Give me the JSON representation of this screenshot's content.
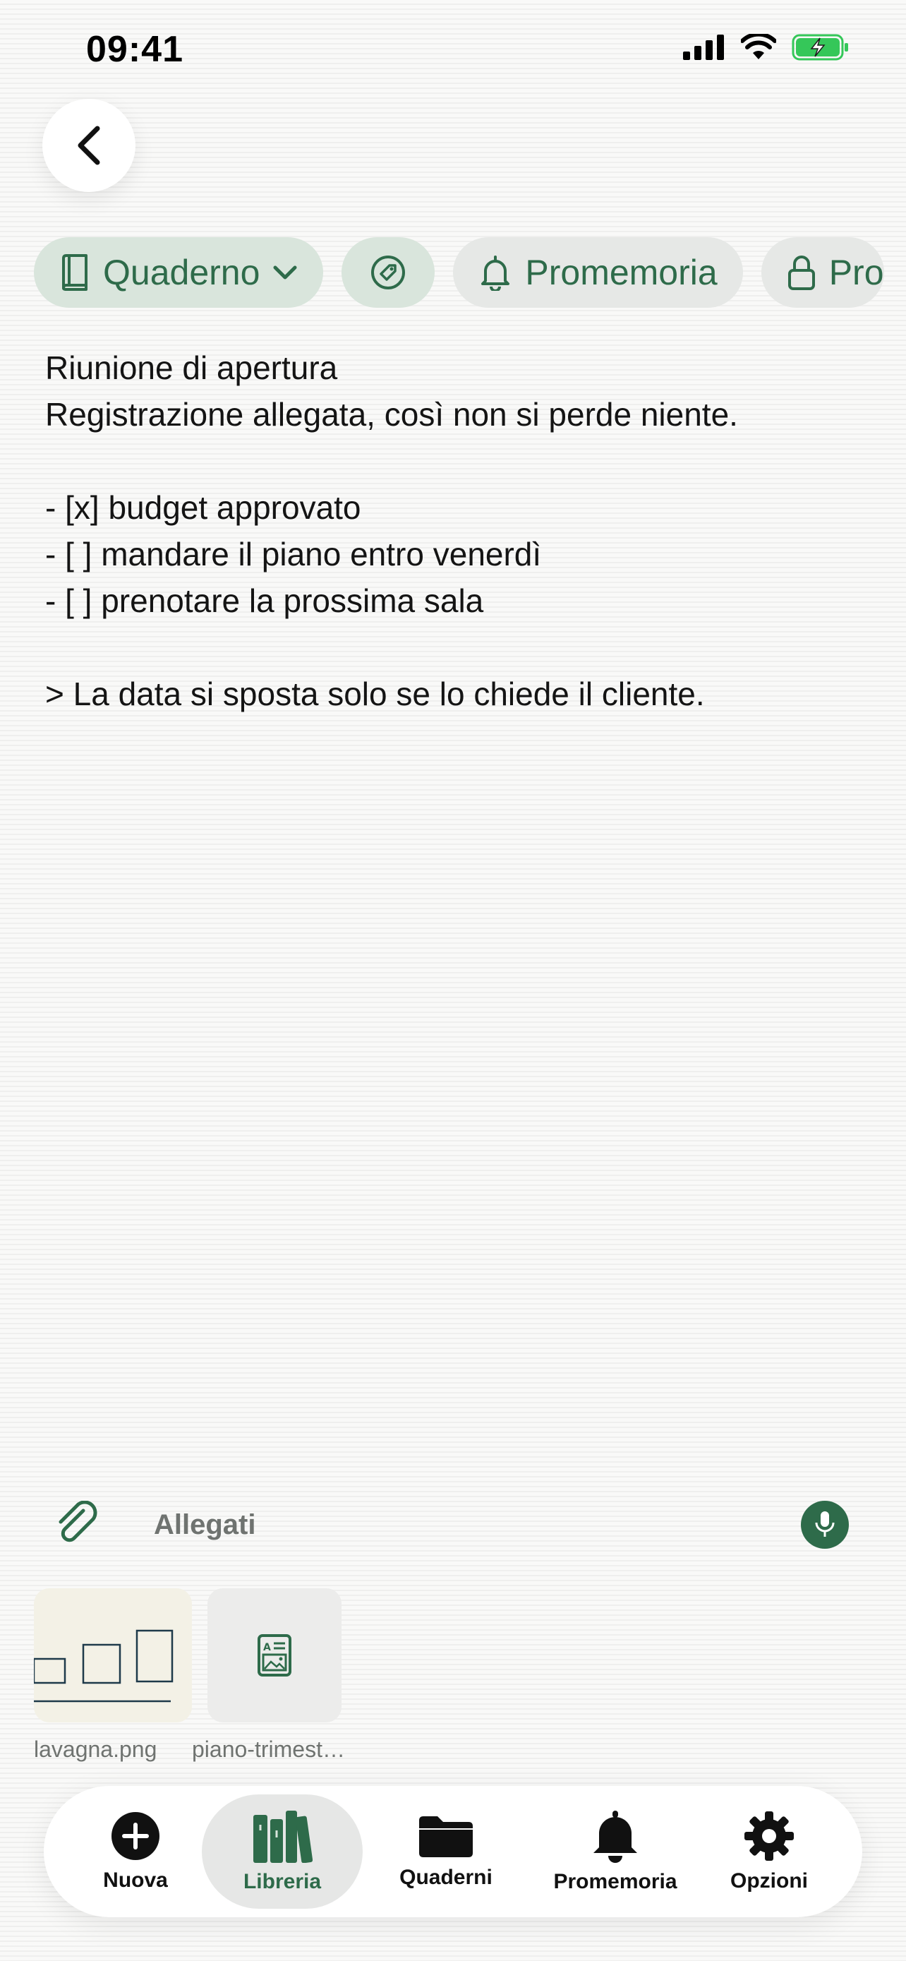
{
  "status_bar": {
    "time": "09:41",
    "icons": [
      "signal-icon",
      "wifi-icon",
      "battery-charging-icon"
    ]
  },
  "toolbar": {
    "back_icon": "chevron-left-icon"
  },
  "chips": [
    {
      "label": "Quaderno",
      "icon": "notebook-icon",
      "has_dropdown": true
    },
    {
      "label": "",
      "icon": "tag-icon"
    },
    {
      "label": "Promemoria",
      "icon": "bell-icon"
    },
    {
      "label": "Pro",
      "icon": "lock-icon"
    }
  ],
  "note": {
    "lines": [
      "Riunione di apertura",
      "Registrazione allegata, così non si perde niente.",
      "",
      "- [x] budget approvato",
      "- [ ] mandare il piano entro venerdì",
      "- [ ] prenotare la prossima sala",
      "",
      "> La data si sposta solo se lo chiede il cliente."
    ]
  },
  "attachments": {
    "label": "Allegati",
    "items": [
      {
        "name": "lavagna.png",
        "icon": "image-preview"
      },
      {
        "name": "piano-trimest…",
        "icon": "document-image-icon"
      }
    ]
  },
  "tabbar": {
    "items": [
      {
        "label": "Nuova",
        "icon": "plus-circle-icon",
        "active": false
      },
      {
        "label": "Libreria",
        "icon": "books-icon",
        "active": true
      },
      {
        "label": "Quaderni",
        "icon": "folder-icon",
        "active": false
      },
      {
        "label": "Promemoria",
        "icon": "bell-icon",
        "active": false
      },
      {
        "label": "Opzioni",
        "icon": "gear-icon",
        "active": false
      }
    ]
  },
  "colors": {
    "accent": "#2e6b4a",
    "chip_bg": "#d9e5dc",
    "chip_neutral": "#e6e8e6",
    "battery": "#35c759"
  }
}
